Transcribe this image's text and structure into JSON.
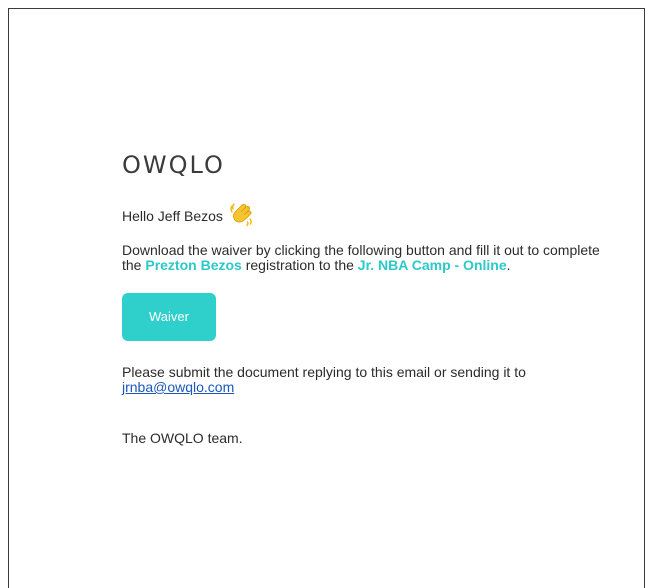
{
  "brand": {
    "logo_text": "OWQLO",
    "accent_color": "#2cc9c9",
    "button_color": "#2fd0cc",
    "link_color": "#1a57b8"
  },
  "greeting": {
    "text": "Hello Jeff Bezos",
    "icon": "waving-hand-icon"
  },
  "message": {
    "part1": "Download the waiver by clicking the following button and fill it out to complete the ",
    "participant": "Prezton Bezos",
    "part2": " registration to the ",
    "camp": "Jr. NBA Camp - Online",
    "part3": "."
  },
  "button": {
    "label": "Waiver"
  },
  "submit": {
    "text": "Please submit the document replying to this email or sending it to ",
    "email": "jrnba@owqlo.com"
  },
  "signoff": {
    "text": "The OWQLO team."
  }
}
